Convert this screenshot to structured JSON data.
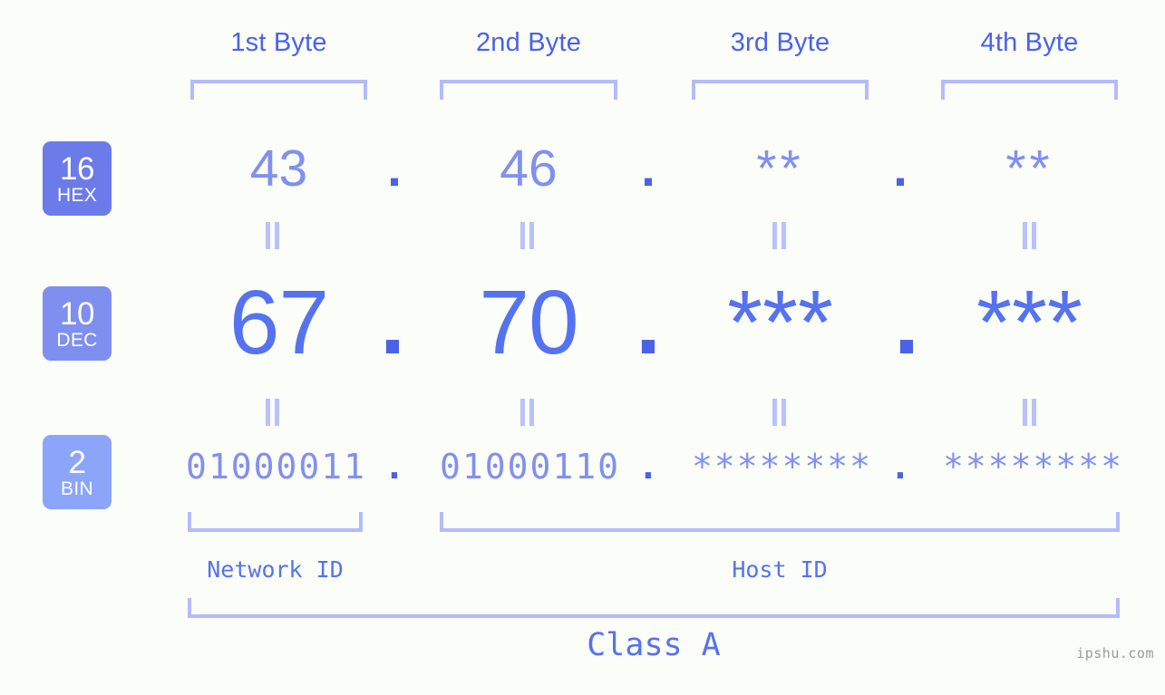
{
  "headers": [
    {
      "label": "1st Byte"
    },
    {
      "label": "2nd Byte"
    },
    {
      "label": "3rd Byte"
    },
    {
      "label": "4th Byte"
    }
  ],
  "bases": [
    {
      "radix": "16",
      "name": "HEX",
      "color": "#6b7bea"
    },
    {
      "radix": "10",
      "name": "DEC",
      "color": "#7f8fef"
    },
    {
      "radix": "2",
      "name": "BIN",
      "color": "#8ba5fb"
    }
  ],
  "rows": {
    "hex": {
      "values": [
        "43",
        "46",
        "**",
        "**"
      ],
      "separator": "."
    },
    "dec": {
      "values": [
        "67",
        "70",
        "***",
        "***"
      ],
      "separator": "."
    },
    "bin": {
      "values": [
        "01000011",
        "01000110",
        "********",
        "********"
      ],
      "separator": "."
    }
  },
  "equals_mark": "||",
  "segments": {
    "network_id": "Network ID",
    "host_id": "Host ID",
    "class": "Class A"
  },
  "watermark": "ipshu.com",
  "colors": {
    "background": "#fbfdf9",
    "accent_strong": "#4a62e8",
    "accent_mid": "#5572f0",
    "accent_light": "#8190ef",
    "bracket": "#b3bcfb",
    "equals": "#b9c2fb",
    "watermark": "#9a9a9a"
  }
}
